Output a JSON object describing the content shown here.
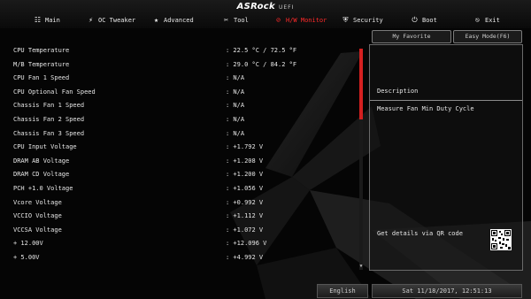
{
  "brand": {
    "logo": "ASRock",
    "suffix": "UEFI"
  },
  "tabs": [
    {
      "label": "Main",
      "icon": "grid-icon",
      "glyph": "☷"
    },
    {
      "label": "OC Tweaker",
      "icon": "rocket-icon",
      "glyph": "⚡"
    },
    {
      "label": "Advanced",
      "icon": "star-icon",
      "glyph": "★"
    },
    {
      "label": "Tool",
      "icon": "tool-icon",
      "glyph": "✂"
    },
    {
      "label": "H/W Monitor",
      "icon": "monitor-icon",
      "glyph": "⊘",
      "active": true
    },
    {
      "label": "Security",
      "icon": "shield-icon",
      "glyph": "⛨"
    },
    {
      "label": "Boot",
      "icon": "power-icon",
      "glyph": "⏻"
    },
    {
      "label": "Exit",
      "icon": "exit-icon",
      "glyph": "⎋"
    }
  ],
  "buttons": {
    "my_favorite": "My Favorite",
    "easy_mode": "Easy Mode(F6)"
  },
  "monitor": {
    "rows": [
      {
        "label": "CPU Temperature",
        "value": ": 22.5 °C /  72.5 °F"
      },
      {
        "label": "M/B Temperature",
        "value": ": 29.0 °C /  84.2 °F"
      },
      {
        "label": "CPU Fan 1 Speed",
        "value": ": N/A"
      },
      {
        "label": "CPU Optional Fan Speed",
        "value": ": N/A"
      },
      {
        "label": "Chassis Fan 1 Speed",
        "value": ": N/A"
      },
      {
        "label": "Chassis Fan 2 Speed",
        "value": ": N/A"
      },
      {
        "label": "Chassis Fan 3 Speed",
        "value": ": N/A"
      },
      {
        "label": "CPU Input Voltage",
        "value": ": +1.792 V"
      },
      {
        "label": "DRAM AB Voltage",
        "value": ": +1.208 V"
      },
      {
        "label": "DRAM CD Voltage",
        "value": ": +1.200 V"
      },
      {
        "label": "PCH +1.0 Voltage",
        "value": ": +1.056 V"
      },
      {
        "label": "Vcore Voltage",
        "value": ": +0.992 V"
      },
      {
        "label": "VCCIO Voltage",
        "value": ": +1.112 V"
      },
      {
        "label": "VCCSA Voltage",
        "value": ": +1.072 V"
      },
      {
        "label": "+ 12.00V",
        "value": ": +12.096 V"
      },
      {
        "label": "+ 5.00V",
        "value": ": +4.992 V"
      }
    ]
  },
  "description": {
    "title": "Description",
    "text": "Measure Fan Min Duty Cycle",
    "qr_label": "Get details via QR code"
  },
  "footer": {
    "language": "English",
    "datetime": "Sat 11/18/2017, 12:51:13"
  },
  "colors": {
    "accent": "#d42020",
    "active_tab": "#ff2a2a"
  }
}
